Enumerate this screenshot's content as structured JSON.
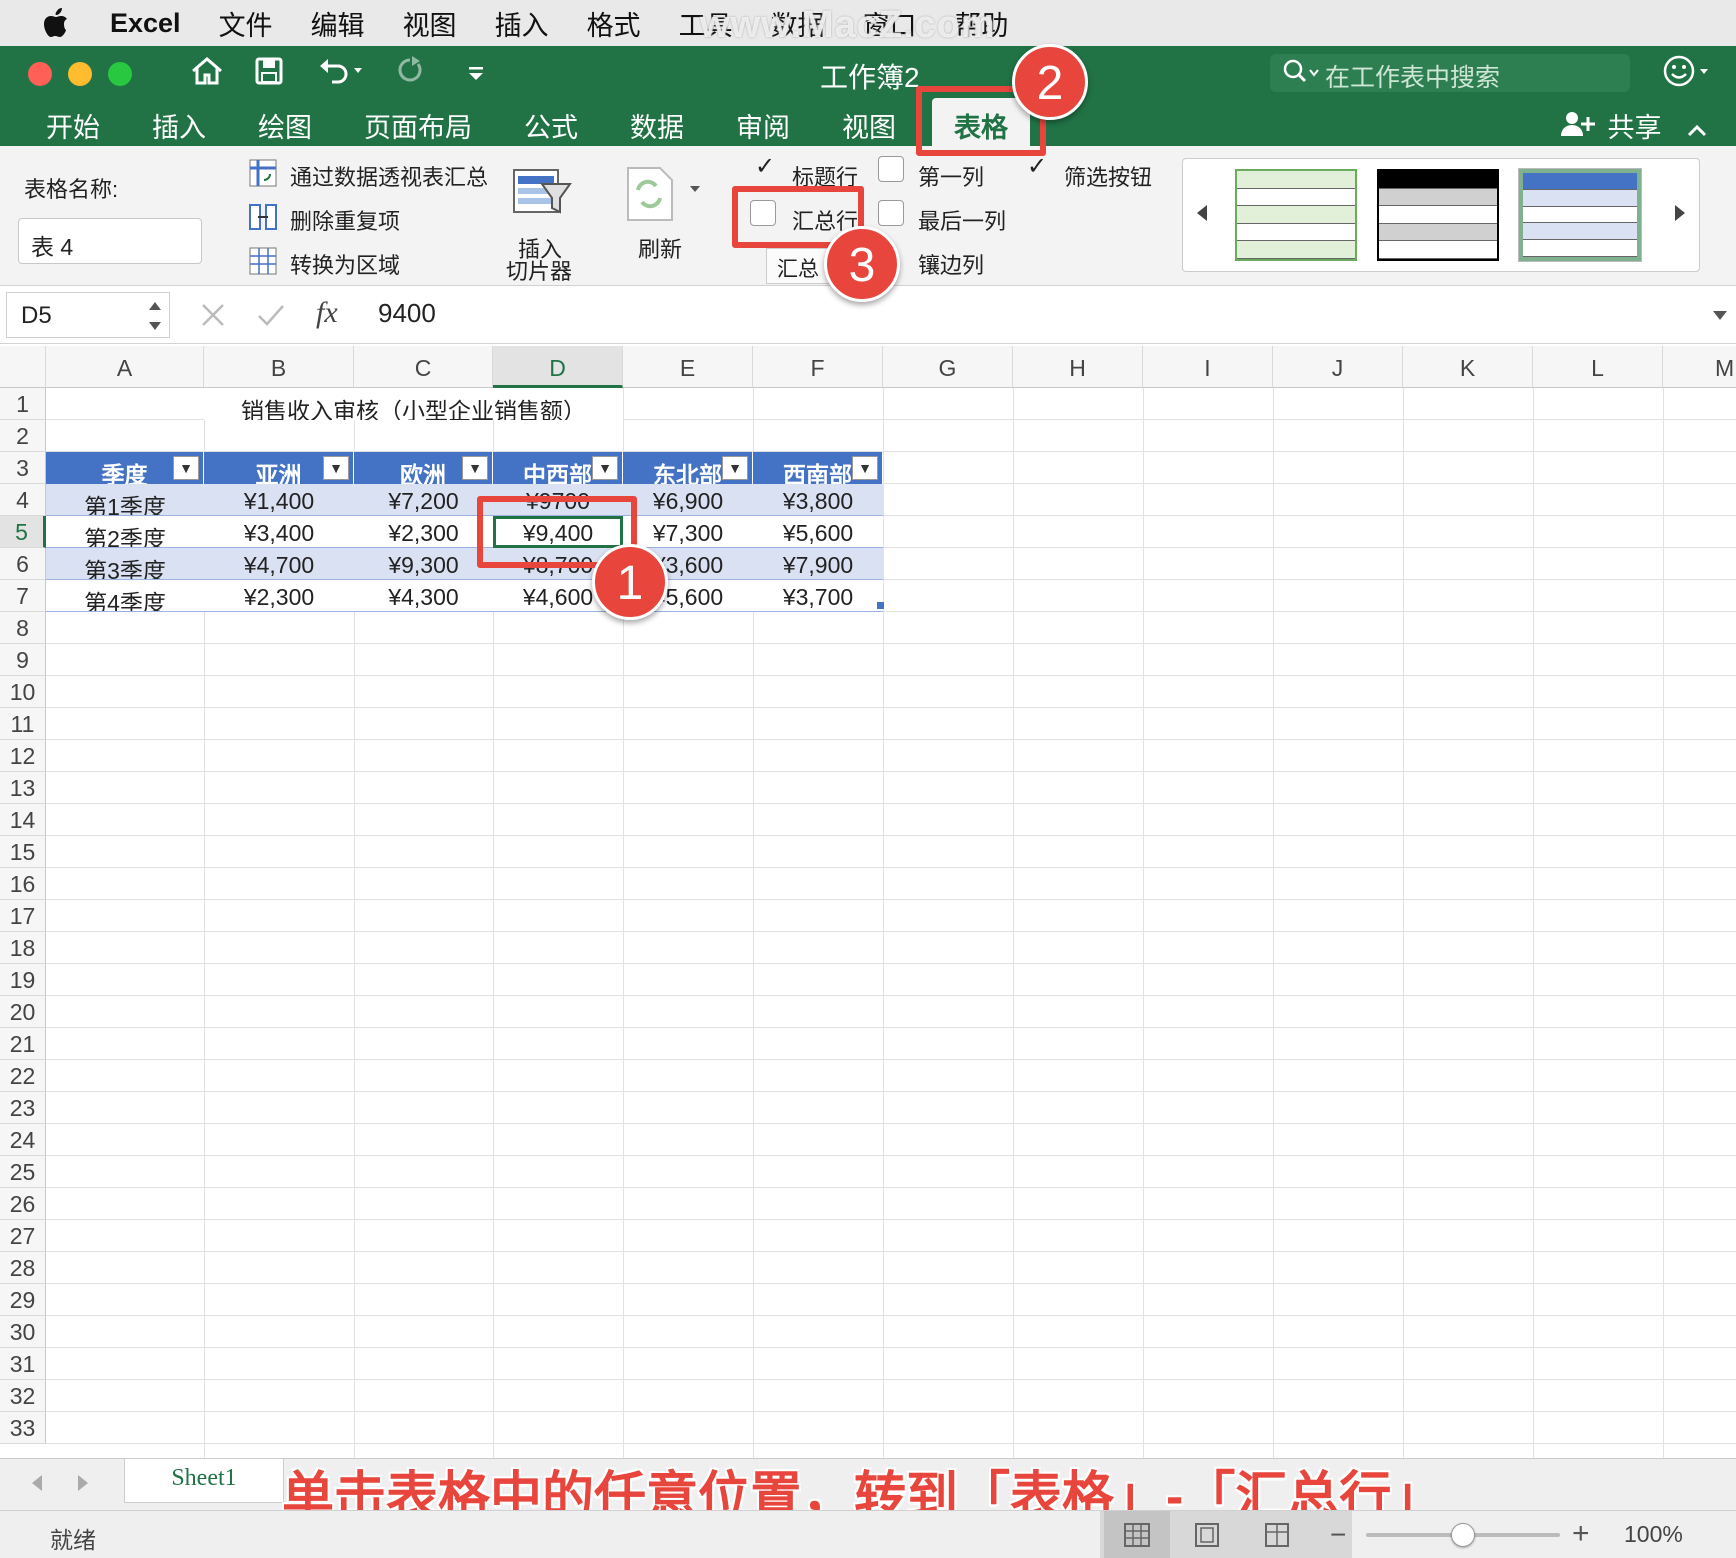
{
  "menubar": {
    "app_name": "Excel",
    "items": [
      "文件",
      "编辑",
      "视图",
      "插入",
      "格式",
      "工具",
      "数据",
      "窗口",
      "帮助"
    ],
    "watermark": "www.MacZ.com"
  },
  "titlebar": {
    "doc_title": "工作簿2",
    "search_placeholder": "在工作表中搜索"
  },
  "tabs": [
    "开始",
    "插入",
    "绘图",
    "页面布局",
    "公式",
    "数据",
    "审阅",
    "视图",
    "表格"
  ],
  "active_tab": "表格",
  "share_label": "共享",
  "ribbon": {
    "table_name_label": "表格名称:",
    "table_name_value": "表 4",
    "summarize_pivot": "通过数据透视表汇总",
    "remove_duplicates": "删除重复项",
    "convert_to_range": "转换为区域",
    "insert_slicer_1": "插入",
    "insert_slicer_2": "切片器",
    "refresh": "刷新",
    "header_row": "标题行",
    "total_row": "汇总行",
    "banded_rows_tooltip": "汇总",
    "first_column": "第一列",
    "last_column": "最后一列",
    "banded_columns": "镶边列",
    "filter_button": "筛选按钮",
    "checks": {
      "header_row": true,
      "total_row": false,
      "first_column": false,
      "last_column": false,
      "filter_button": true
    }
  },
  "formula": {
    "cell_ref": "D5",
    "value": "9400"
  },
  "columns": [
    "A",
    "B",
    "C",
    "D",
    "E",
    "F",
    "G",
    "H",
    "I",
    "J",
    "K",
    "L",
    "M"
  ],
  "rows": [
    "1",
    "2",
    "3",
    "4",
    "5",
    "6",
    "7",
    "8",
    "9",
    "10",
    "11",
    "12",
    "13",
    "14",
    "15",
    "16",
    "17",
    "18",
    "19",
    "20",
    "21",
    "22",
    "23",
    "24",
    "25",
    "26",
    "27",
    "28",
    "29",
    "30",
    "31",
    "32",
    "33"
  ],
  "sheet": {
    "title": "销售收入审核（小型企业销售额）",
    "headers": [
      "季度",
      "亚洲",
      "欧洲",
      "中西部",
      "东北部",
      "西南部"
    ],
    "data": [
      [
        "第1季度",
        "¥1,400",
        "¥7,200",
        "¥9700",
        "¥6,900",
        "¥3,800"
      ],
      [
        "第2季度",
        "¥3,400",
        "¥2,300",
        "¥9,400",
        "¥7,300",
        "¥5,600"
      ],
      [
        "第3季度",
        "¥4,700",
        "¥9,300",
        "¥8,700",
        "¥3,600",
        "¥7,900"
      ],
      [
        "第4季度",
        "¥2,300",
        "¥4,300",
        "¥4,600",
        "¥5,600",
        "¥3,700"
      ]
    ]
  },
  "sheet_tab": "Sheet1",
  "caption": "单击表格中的任意位置，转到「表格」-「汇总行」",
  "badges": [
    "1",
    "2",
    "3"
  ],
  "status": {
    "ready": "就绪",
    "zoom": "100%",
    "zoom_level": 0.5
  },
  "colors": {
    "excel_green": "#217346",
    "table_header": "#4472c4",
    "band": "#d9e1f2",
    "annotation_red": "#e8453c"
  }
}
